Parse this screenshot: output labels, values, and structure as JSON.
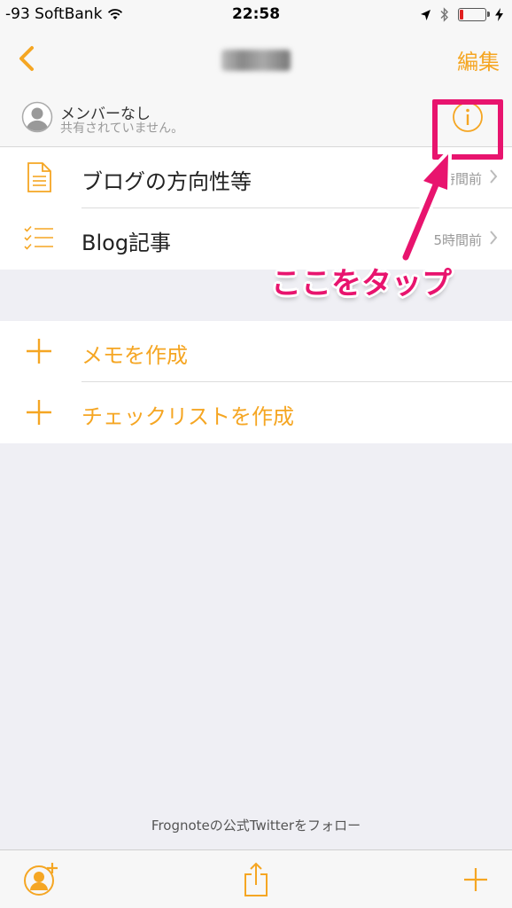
{
  "status_bar": {
    "carrier": "-93 SoftBank",
    "time": "22:58",
    "battery_level": 0.15
  },
  "nav": {
    "back_icon": "chevron-left-icon",
    "edit_label": "編集"
  },
  "member": {
    "name": "メンバーなし",
    "subtitle": "共有されていません。",
    "info_icon": "info-icon"
  },
  "notes": [
    {
      "label": "ブログの方向性等",
      "time": "5時間前",
      "icon": "document-icon"
    },
    {
      "label": "Blog記事",
      "time": "5時間前",
      "icon": "checklist-icon"
    }
  ],
  "actions": [
    {
      "label": "メモを作成",
      "icon": "plus-icon"
    },
    {
      "label": "チェックリストを作成",
      "icon": "plus-icon"
    }
  ],
  "footer": {
    "link_text": "Frognoteの公式Twitterをフォロー"
  },
  "toolbar": {
    "add_member_icon": "add-person-icon",
    "share_icon": "share-icon",
    "add_icon": "plus-icon"
  },
  "annotation": {
    "text": "ここをタップ"
  },
  "colors": {
    "accent": "#f5a623",
    "annotation": "#e8146e",
    "battery": "#e02020"
  }
}
